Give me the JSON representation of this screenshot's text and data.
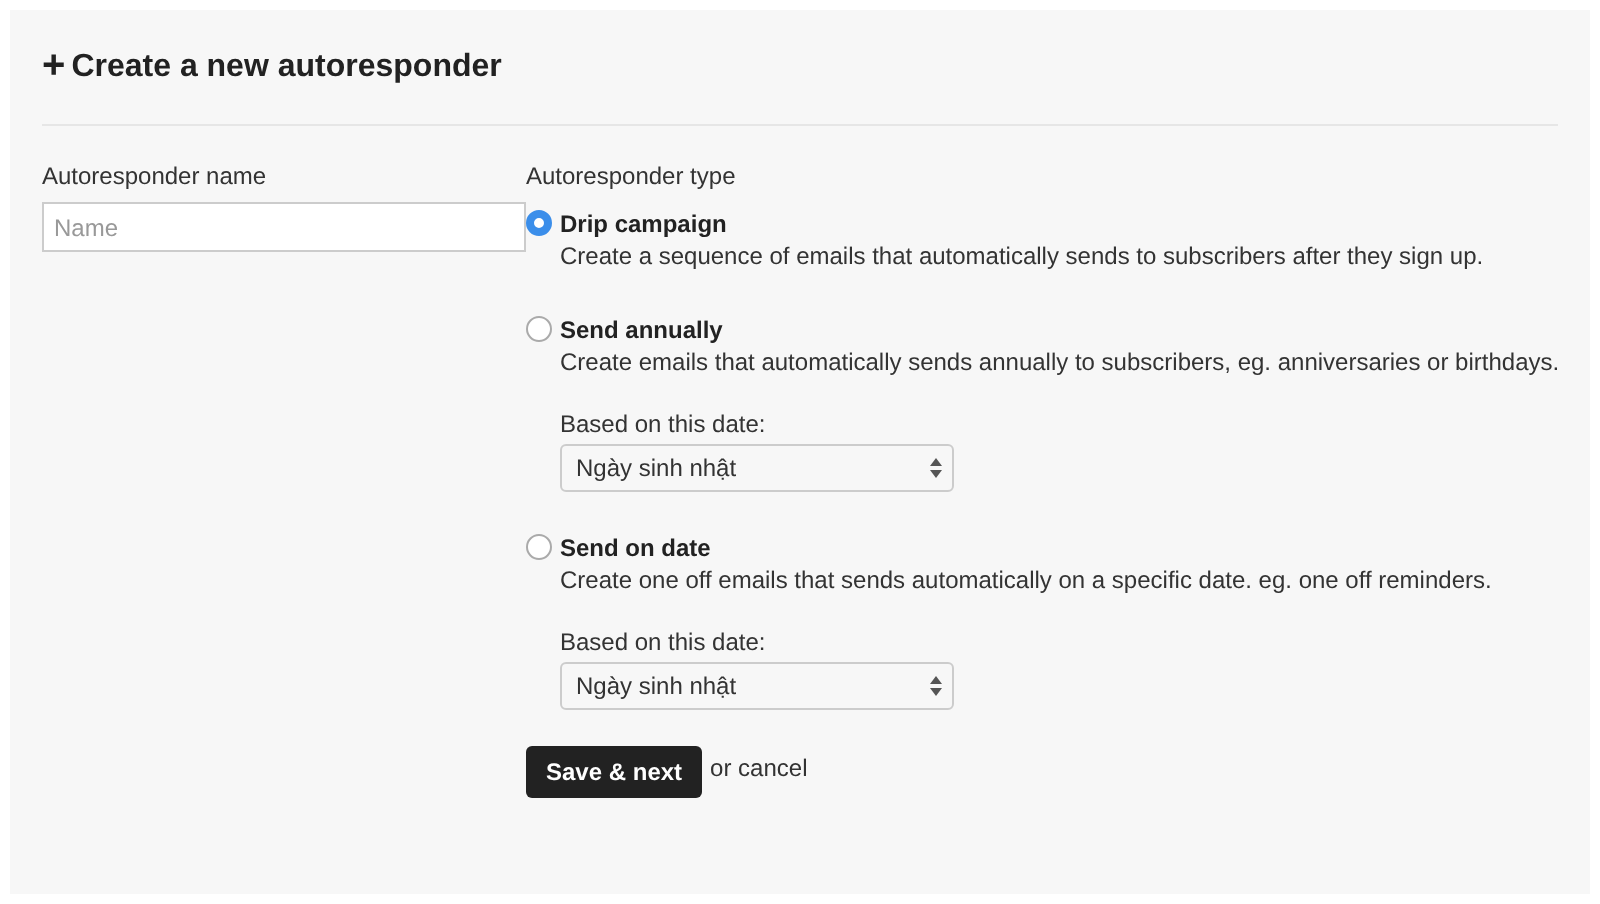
{
  "header": {
    "icon": "+",
    "title": "Create a new autoresponder"
  },
  "name_field": {
    "label": "Autoresponder name",
    "placeholder": "Name"
  },
  "type_group": {
    "label": "Autoresponder type",
    "options": [
      {
        "title": "Drip campaign",
        "description": "Create a sequence of emails that automatically sends to subscribers after they sign up.",
        "selected": true
      },
      {
        "title": "Send annually",
        "description": "Create emails that automatically sends annually to subscribers, eg. anniversaries or birthdays.",
        "selected": false,
        "date_select": {
          "label": "Based on this date:",
          "value": "Ngày sinh nhật"
        }
      },
      {
        "title": "Send on date",
        "description": "Create one off emails that sends automatically on a specific date. eg. one off reminders.",
        "selected": false,
        "date_select": {
          "label": "Based on this date:",
          "value": "Ngày sinh nhật"
        }
      }
    ]
  },
  "actions": {
    "primary": "Save & next",
    "secondary": "or cancel"
  }
}
